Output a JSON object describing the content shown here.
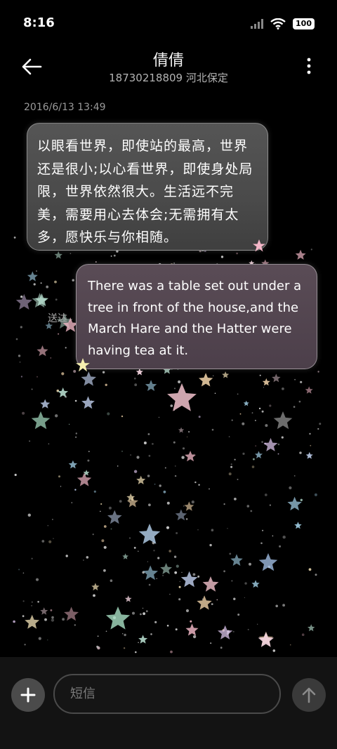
{
  "status_bar": {
    "time": "8:16",
    "battery": "100"
  },
  "header": {
    "title": "倩倩",
    "subtitle": "18730218809 河北保定"
  },
  "conversation": {
    "timestamp": "2016/6/13 13:49",
    "messages": [
      {
        "direction": "incoming",
        "text": "以眼看世界，即使站的最高，世界还是很小;以心看世界，即使身处局限，世界依然很大。生活远不完美，需要用心去体会;无需拥有太多，愿快乐与你相随。"
      },
      {
        "direction": "outgoing",
        "text": "There was a table set out under a tree in front of the house,and the March Hare and the Hatter were having tea at it.",
        "status": "送达"
      }
    ]
  },
  "composer": {
    "placeholder": "短信"
  },
  "icons": {
    "back": "arrow-left-icon",
    "more": "more-vertical-icon",
    "attach": "plus-icon",
    "send": "arrow-up-icon",
    "signal": "signal-icon",
    "wifi": "wifi-icon",
    "battery": "battery-icon"
  },
  "colors": {
    "background": "#000000",
    "incoming_bubble": "#4a4a4a",
    "outgoing_bubble": "#4c3f4a",
    "muted_text": "#9a9a9a"
  }
}
